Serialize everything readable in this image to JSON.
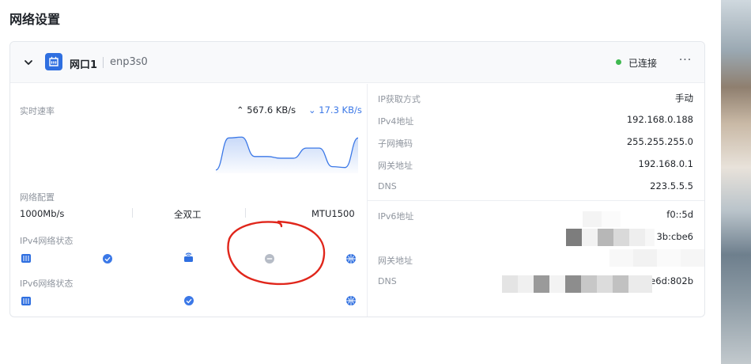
{
  "page": {
    "title": "网络设置"
  },
  "card": {
    "port_name": "网口1",
    "device": "enp3s0",
    "status": "已连接",
    "more": "···"
  },
  "left": {
    "speed_label": "实时速率",
    "upload": "567.6 KB/s",
    "download": "17.3 KB/s",
    "config_label": "网络配置",
    "speed": "1000Mb/s",
    "duplex": "全双工",
    "mtu": "MTU1500",
    "ipv4_status_label": "IPv4网络状态",
    "ipv6_status_label": "IPv6网络状态"
  },
  "ipv4": [
    {
      "label": "IP获取方式",
      "value": "手动"
    },
    {
      "label": "IPv4地址",
      "value": "192.168.0.188"
    },
    {
      "label": "子网掩码",
      "value": "255.255.255.0"
    },
    {
      "label": "网关地址",
      "value": "192.168.0.1"
    },
    {
      "label": "DNS",
      "value": "223.5.5.5"
    }
  ],
  "ipv6": [
    {
      "label": "IPv6地址",
      "value": "f0::5d"
    },
    {
      "label": "",
      "value": "3b:cbe6"
    },
    {
      "label": "网关地址",
      "value": ""
    },
    {
      "label": "DNS",
      "value": "e6d:802b"
    }
  ],
  "colors": {
    "accent": "#3b78e7",
    "connected": "#3fb950",
    "annotation": "#e0261b"
  },
  "chart_data": {
    "type": "area",
    "series": [
      {
        "values": [
          2,
          40,
          41,
          18,
          18,
          16,
          16,
          28,
          28,
          6,
          5,
          40
        ]
      }
    ],
    "ylim": [
      0,
      45
    ]
  }
}
